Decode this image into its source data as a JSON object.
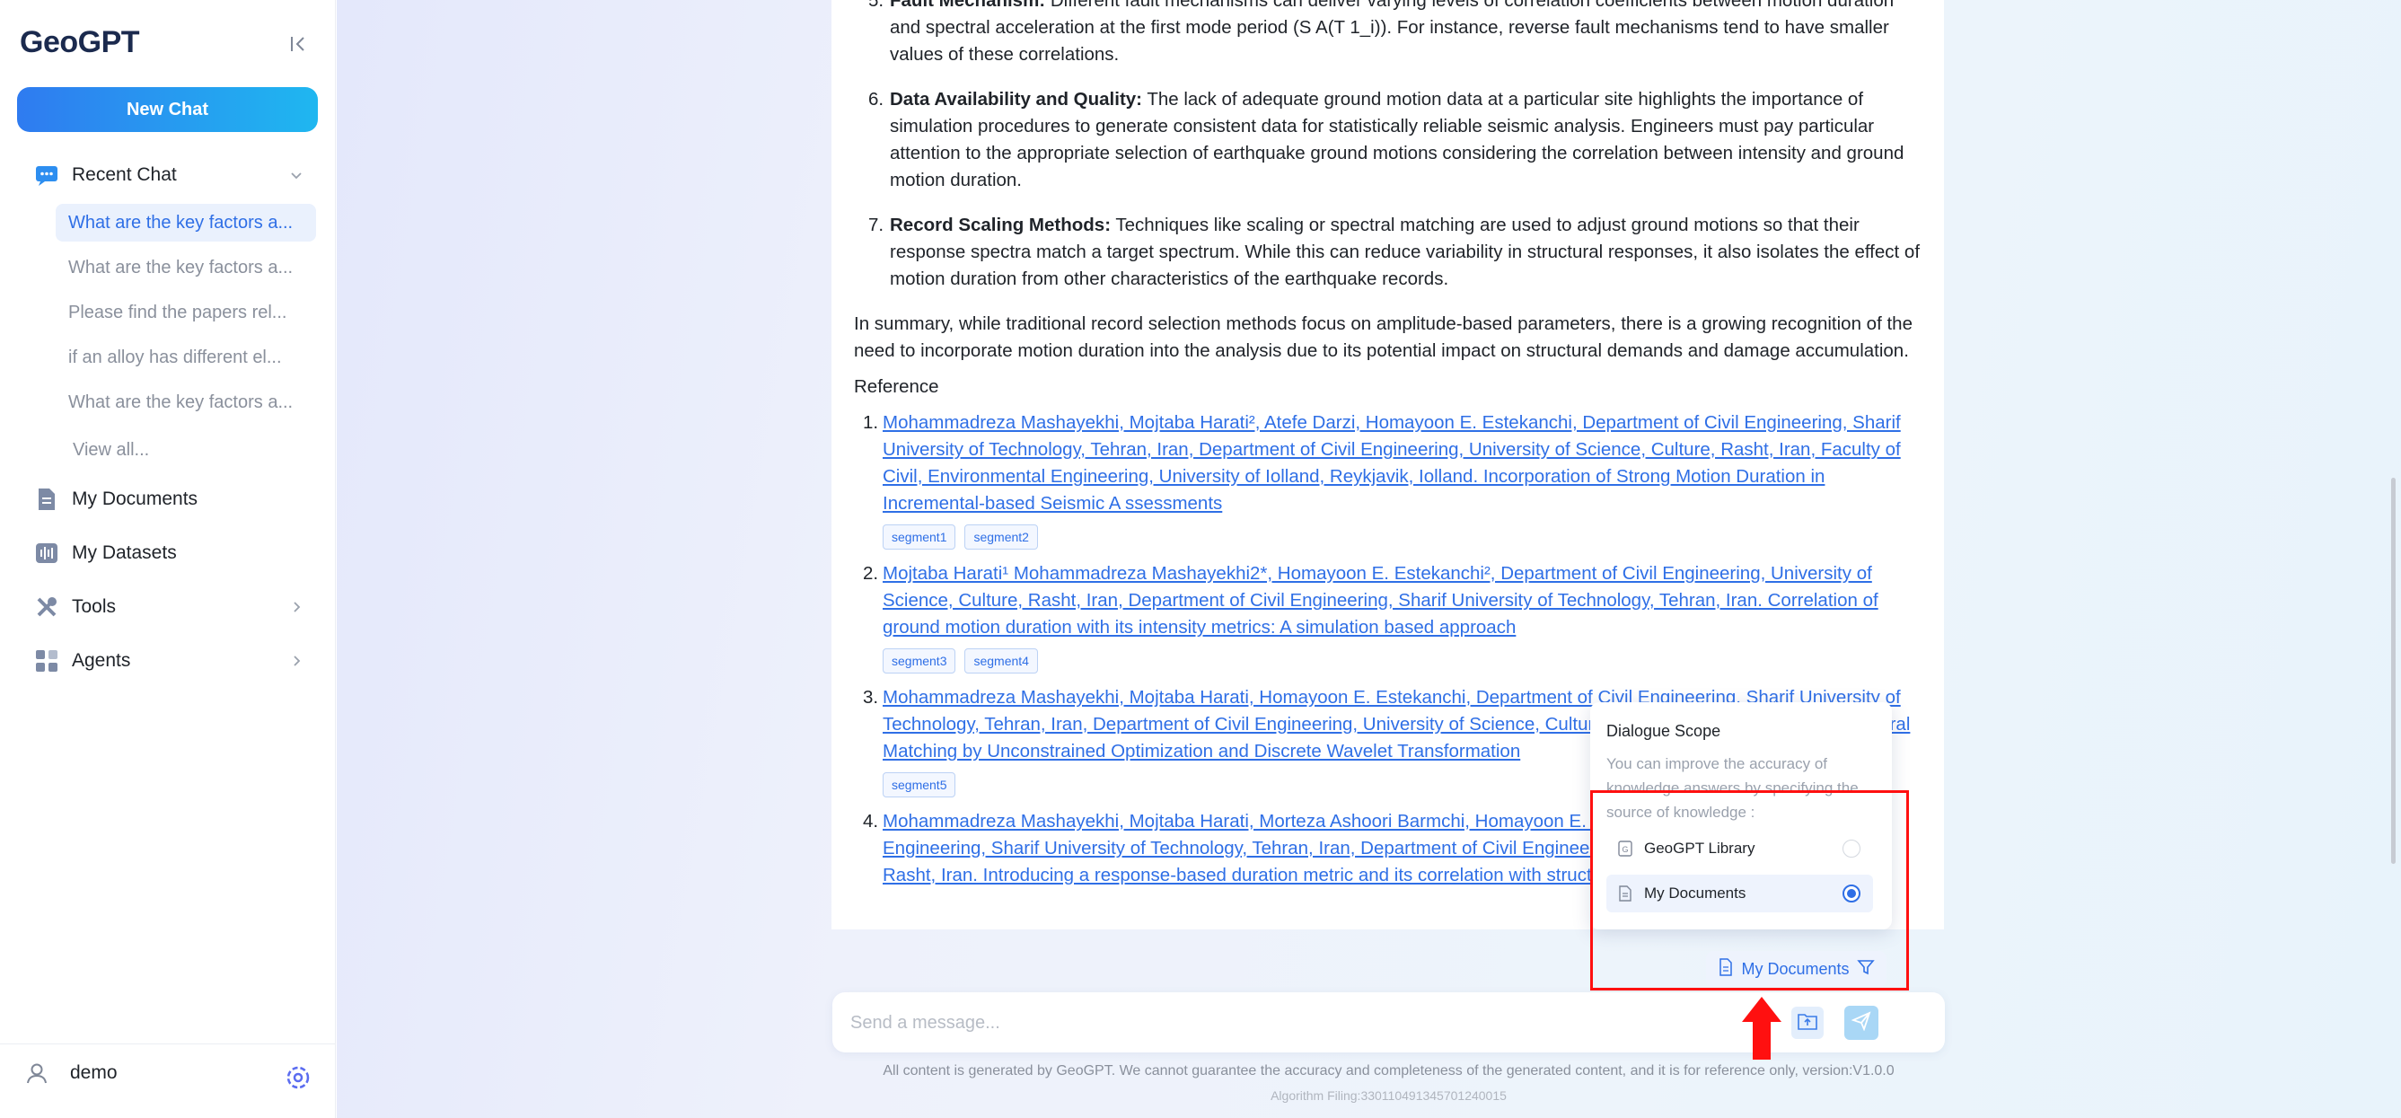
{
  "app": {
    "title": "GeoGPT"
  },
  "sidebar": {
    "new_chat": "New Chat",
    "recent_chat": "Recent Chat",
    "chats": [
      "What are the key factors a...",
      "What are the key factors a...",
      "Please find the papers rel...",
      "if an alloy has different el...",
      "What are the key factors a..."
    ],
    "view_all": "View all...",
    "my_documents": "My Documents",
    "my_datasets": "My Datasets",
    "tools": "Tools",
    "agents": "Agents",
    "user": "demo"
  },
  "answer": {
    "points": [
      {
        "num": "5.",
        "title": "Fault Mechanism:",
        "text": " Different fault mechanisms can deliver varying levels of correlation coefficients between motion duration and spectral acceleration at the first mode period (S A(T 1_i)). For instance, reverse fault mechanisms tend to have smaller values of these correlations."
      },
      {
        "num": "6.",
        "title": "Data Availability and Quality:",
        "text": " The lack of adequate ground motion data at a particular site highlights the importance of simulation procedures to generate consistent data for statistically reliable seismic analysis. Engineers must pay particular attention to the appropriate selection of earthquake ground motions considering the correlation between intensity and ground motion duration."
      },
      {
        "num": "7.",
        "title": "Record Scaling Methods:",
        "text": " Techniques like scaling or spectral matching are used to adjust ground motions so that their response spectra match a target spectrum. While this can reduce variability in structural responses, it also isolates the effect of motion duration from other characteristics of the earthquake records."
      }
    ],
    "summary": "In summary, while traditional record selection methods focus on amplitude-based parameters, there is a growing recognition of the need to incorporate motion duration into the analysis due to its potential impact on structural demands and damage accumulation.",
    "reference_label": "Reference",
    "references": [
      {
        "num": "1.",
        "text": "Mohammadreza Mashayekhi, Mojtaba Harati², Atefe Darzi, Homayoon E. Estekanchi, Department of Civil Engineering, Sharif University of Technology, Tehran, Iran, Department of Civil Engineering, University of Science, Culture, Rasht, Iran, Faculty of Civil, Environmental Engineering, University of Iolland, Reykjavik, Iolland. Incorporation of Strong Motion Duration in Incremental-based Seismic A ssessments",
        "segments": [
          "segment1",
          "segment2"
        ]
      },
      {
        "num": "2.",
        "text": "Mojtaba Harati¹ Mohammadreza Mashayekhi2*, Homayoon E. Estekanchi², Department of Civil Engineering, University of Science, Culture, Rasht, Iran, Department of Civil Engineering, Sharif University of Technology, Tehran, Iran. Correlation of ground motion duration with its intensity metrics: A simulation based approach",
        "segments": [
          "segment3",
          "segment4"
        ]
      },
      {
        "num": "3.",
        "text": "Mohammadreza Mashayekhi, Mojtaba Harati, Homayoon E. Estekanchi, Department of Civil Engineering, Sharif University of Technology, Tehran, Iran, Department of Civil Engineering, University of Science, Culture, Rasht, Iran. Non-Stationary Spectral Matching by Unconstrained Optimization and Discrete Wavelet Transformation",
        "segments": [
          "segment5"
        ]
      },
      {
        "num": "4.",
        "text": "Mohammadreza Mashayekhi, Mojtaba Harati, Morteza Ashoori Barmchi, Homayoon E. Estekanchi, Department of Civil Engineering, Sharif University of Technology, Tehran, Iran, Department of Civil Engineering, University of Science, Culture, Rasht, Iran. Introducing a response-based duration metric and its correlation with structural damages",
        "segments": []
      }
    ]
  },
  "scope": {
    "title": "Dialogue Scope",
    "description": "You can improve the accuracy of knowledge answers by specifying the source of knowledge :",
    "option_library": "GeoGPT Library",
    "option_documents": "My Documents",
    "selected": "My Documents",
    "button_label": "My Documents"
  },
  "input": {
    "placeholder": "Send a message..."
  },
  "footer": {
    "disclaimer": "All content is generated by GeoGPT. We cannot guarantee the accuracy and completeness of the generated content, and it is for reference only, version:V1.0.0",
    "filing": "Algorithm Filing:330110491345701240015"
  },
  "colors": {
    "accent": "#2f6fe6",
    "highlight": "#ff1010"
  }
}
